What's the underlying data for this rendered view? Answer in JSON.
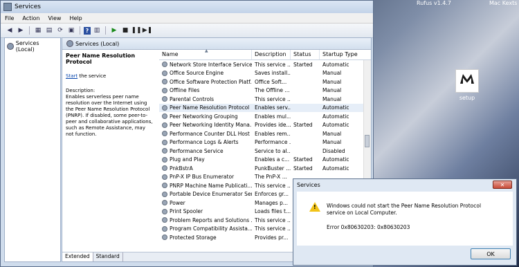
{
  "desktop": {
    "rufus_label": "Rufus v1.4.7",
    "machd_label": "Mac Kexts",
    "icon_label": "setup"
  },
  "window": {
    "title": "Services",
    "menu": [
      "File",
      "Action",
      "View",
      "Help"
    ]
  },
  "tree": {
    "root": "Services (Local)"
  },
  "main": {
    "header": "Services (Local)",
    "selected_service": "Peer Name Resolution Protocol",
    "start_link": "Start",
    "start_suffix": " the service",
    "description_label": "Description:",
    "description_text": "Enables serverless peer name resolution over the Internet using the Peer Name Resolution Protocol (PNRP). If disabled, some peer-to-peer and collaborative applications, such as Remote Assistance, may not function.",
    "columns": [
      "Name",
      "Description",
      "Status",
      "Startup Type"
    ],
    "rows": [
      {
        "name": "Network Store Interface Service",
        "desc": "This service ...",
        "status": "Started",
        "startup": "Automatic"
      },
      {
        "name": "Office  Source Engine",
        "desc": "Saves install...",
        "status": "",
        "startup": "Manual"
      },
      {
        "name": "Office Software Protection Platf...",
        "desc": "Office Soft...",
        "status": "",
        "startup": "Manual"
      },
      {
        "name": "Offline Files",
        "desc": "The Offline ...",
        "status": "",
        "startup": "Manual"
      },
      {
        "name": "Parental Controls",
        "desc": "This service ...",
        "status": "",
        "startup": "Manual"
      },
      {
        "name": "Peer Name Resolution Protocol",
        "desc": "Enables serv...",
        "status": "",
        "startup": "Automatic"
      },
      {
        "name": "Peer Networking Grouping",
        "desc": "Enables mul...",
        "status": "",
        "startup": "Automatic"
      },
      {
        "name": "Peer Networking Identity Mana...",
        "desc": "Provides ide...",
        "status": "Started",
        "startup": "Automatic"
      },
      {
        "name": "Performance Counter DLL Host",
        "desc": "Enables rem...",
        "status": "",
        "startup": "Manual"
      },
      {
        "name": "Performance Logs & Alerts",
        "desc": "Performance ...",
        "status": "",
        "startup": "Manual"
      },
      {
        "name": "Performance Service",
        "desc": "Service to al...",
        "status": "",
        "startup": "Disabled"
      },
      {
        "name": "Plug and Play",
        "desc": "Enables a c...",
        "status": "Started",
        "startup": "Automatic"
      },
      {
        "name": "PnkBstrA",
        "desc": "PunkBuster ...",
        "status": "Started",
        "startup": "Automatic"
      },
      {
        "name": "PnP-X IP Bus Enumerator",
        "desc": "The PnP-X ...",
        "status": "",
        "startup": ""
      },
      {
        "name": "PNRP Machine Name Publicati...",
        "desc": "This service ...",
        "status": "",
        "startup": ""
      },
      {
        "name": "Portable Device Enumerator Ser...",
        "desc": "Enforces gr...",
        "status": "",
        "startup": ""
      },
      {
        "name": "Power",
        "desc": "Manages p...",
        "status": "",
        "startup": ""
      },
      {
        "name": "Print Spooler",
        "desc": "Loads files t...",
        "status": "",
        "startup": ""
      },
      {
        "name": "Problem Reports and Solutions ...",
        "desc": "This service ...",
        "status": "",
        "startup": ""
      },
      {
        "name": "Program Compatibility Assista...",
        "desc": "This service ...",
        "status": "",
        "startup": ""
      },
      {
        "name": "Protected Storage",
        "desc": "Provides pr...",
        "status": "",
        "startup": ""
      }
    ],
    "tabs": [
      "Extended",
      "Standard"
    ]
  },
  "dialog": {
    "title": "Services",
    "message": "Windows could not start the Peer Name Resolution Protocol service on Local Computer.",
    "error": "Error 0x80630203: 0x80630203",
    "ok_label": "OK"
  }
}
